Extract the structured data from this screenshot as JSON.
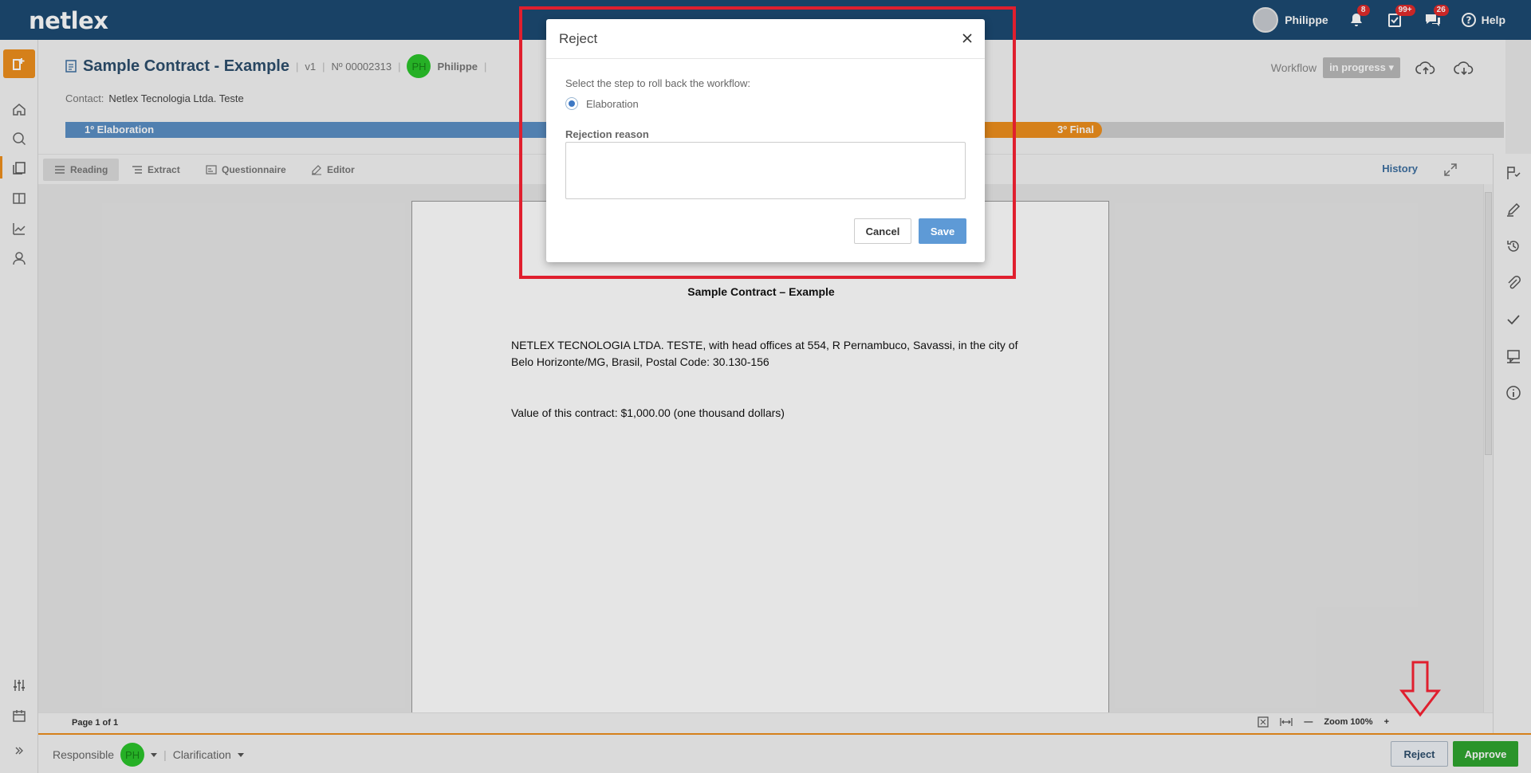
{
  "app": {
    "logo": "netlex"
  },
  "topbar": {
    "user_name": "Philippe",
    "notifications_badge": "8",
    "tasks_badge": "99+",
    "messages_badge": "26",
    "help_label": "Help"
  },
  "document": {
    "title": "Sample Contract - Example",
    "version": "v1",
    "number": "Nº 00002313",
    "owner_initials": "PH",
    "owner_name": "Philippe",
    "contact_label": "Contact:",
    "contact_value": "Netlex Tecnologia Ltda. Teste"
  },
  "workflow": {
    "label": "Workflow",
    "status": "in progress"
  },
  "steps": [
    {
      "label": "1º Elaboration"
    },
    {
      "label": "3º Final"
    }
  ],
  "tabs": [
    {
      "label": "Reading"
    },
    {
      "label": "Extract"
    },
    {
      "label": "Questionnaire"
    },
    {
      "label": "Editor"
    }
  ],
  "history_label": "History",
  "page": {
    "title": "Sample Contract – Example",
    "paragraph1": "NETLEX TECNOLOGIA LTDA. TESTE, with head offices at 554, R Pernambuco, Savassi, in the city of Belo Horizonte/MG, Brasil, Postal Code: 30.130-156",
    "paragraph2": "Value of this contract: $1,000.00 (one thousand dollars)"
  },
  "pagebar": {
    "page_info": "Page 1 of 1",
    "zoom_label": "Zoom 100%"
  },
  "actionbar": {
    "responsible_label": "Responsible",
    "responsible_initials": "PH",
    "stage": "Clarification",
    "reject_label": "Reject",
    "approve_label": "Approve"
  },
  "modal": {
    "title": "Reject",
    "prompt": "Select the step to roll back the workflow:",
    "option": "Elaboration",
    "reason_label": "Rejection reason",
    "reason_value": "",
    "cancel_label": "Cancel",
    "save_label": "Save"
  },
  "colors": {
    "topbar": "#1c4a72",
    "accent_orange": "#ee8f1d",
    "step_blue": "#5b8fc4",
    "approve_green": "#2fa52f",
    "annotation_red": "#e01f2e"
  }
}
